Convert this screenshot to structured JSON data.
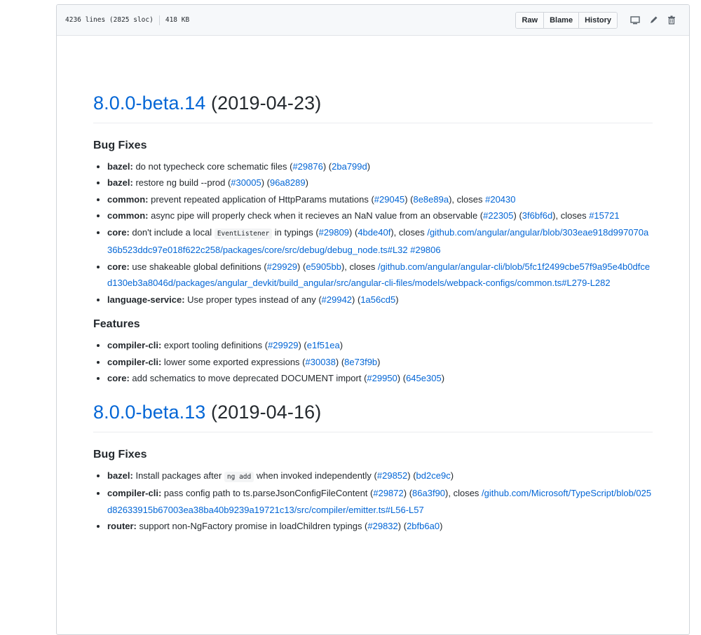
{
  "filebar": {
    "lines": "4236 lines (2825 sloc)",
    "size": "418 KB",
    "raw_label": "Raw",
    "blame_label": "Blame",
    "history_label": "History",
    "icons": [
      "desktop-icon",
      "pencil-icon",
      "trash-icon"
    ]
  },
  "releases": [
    {
      "version": "8.0.0-beta.14",
      "date": "(2019-04-23)",
      "sections": [
        {
          "title": "Bug Fixes",
          "items": [
            {
              "scope": "bazel:",
              "text": " do not typecheck core schematic files (",
              "pr": "#29876",
              "mid": ") (",
              "commit": "2ba799d",
              "end": ")"
            },
            {
              "scope": "bazel:",
              "text": " restore ng build --prod (",
              "pr": "#30005",
              "mid": ") (",
              "commit": "96a8289",
              "end": ")"
            },
            {
              "scope": "common:",
              "text": " prevent repeated application of HttpParams mutations (",
              "pr": "#29045",
              "mid": ") (",
              "commit": "8e8e89a",
              "end": "), closes ",
              "closes": "#20430"
            },
            {
              "scope": "common:",
              "text": " async pipe will properly check when it recieves an NaN value from an observable (",
              "pr": "#22305",
              "mid": ") (",
              "commit": "3f6bf6d",
              "end": "), closes ",
              "closes": "#15721"
            },
            {
              "scope": "core:",
              "text": " don't include a local ",
              "code": "EventListener",
              "text2": " in typings (",
              "pr": "#29809",
              "mid": ") (",
              "commit": "4bde40f",
              "end": "), closes ",
              "closes": "/github.com/angular/angular/blob/303eae918d997070a36b523ddc97e018f622c258/packages/core/src/debug/debug_node.ts#L32 #29806"
            },
            {
              "scope": "core:",
              "text": " use shakeable global definitions (",
              "pr": "#29929",
              "mid": ") (",
              "commit": "e5905bb",
              "end": "), closes ",
              "closes": "/github.com/angular/angular-cli/blob/5fc1f2499cbe57f9a95e4b0dfced130eb3a8046d/packages/angular_devkit/build_angular/src/angular-cli-files/models/webpack-configs/common.ts#L279-L282"
            },
            {
              "scope": "language-service:",
              "text": " Use proper types instead of any (",
              "pr": "#29942",
              "mid": ") (",
              "commit": "1a56cd5",
              "end": ")"
            }
          ]
        },
        {
          "title": "Features",
          "items": [
            {
              "scope": "compiler-cli:",
              "text": " export tooling definitions (",
              "pr": "#29929",
              "mid": ") (",
              "commit": "e1f51ea",
              "end": ")"
            },
            {
              "scope": "compiler-cli:",
              "text": " lower some exported expressions (",
              "pr": "#30038",
              "mid": ") (",
              "commit": "8e73f9b",
              "end": ")"
            },
            {
              "scope": "core:",
              "text": " add schematics to move deprecated DOCUMENT import (",
              "pr": "#29950",
              "mid": ") (",
              "commit": "645e305",
              "end": ")"
            }
          ]
        }
      ]
    },
    {
      "version": "8.0.0-beta.13",
      "date": "(2019-04-16)",
      "sections": [
        {
          "title": "Bug Fixes",
          "items": [
            {
              "scope": "bazel:",
              "text": " Install packages after ",
              "code": "ng add",
              "text2": " when invoked independently (",
              "pr": "#29852",
              "mid": ") (",
              "commit": "bd2ce9c",
              "end": ")"
            },
            {
              "scope": "compiler-cli:",
              "text": " pass config path to ts.parseJsonConfigFileContent (",
              "pr": "#29872",
              "mid": ") (",
              "commit": "86a3f90",
              "end": "), closes ",
              "closes": "/github.com/Microsoft/TypeScript/blob/025d82633915b67003ea38ba40b9239a19721c13/src/compiler/emitter.ts#L56-L57"
            },
            {
              "scope": "router:",
              "text": " support non-NgFactory promise in loadChildren typings (",
              "pr": "#29832",
              "mid": ") (",
              "commit": "2bfb6a0",
              "end": ")"
            }
          ]
        }
      ]
    }
  ]
}
